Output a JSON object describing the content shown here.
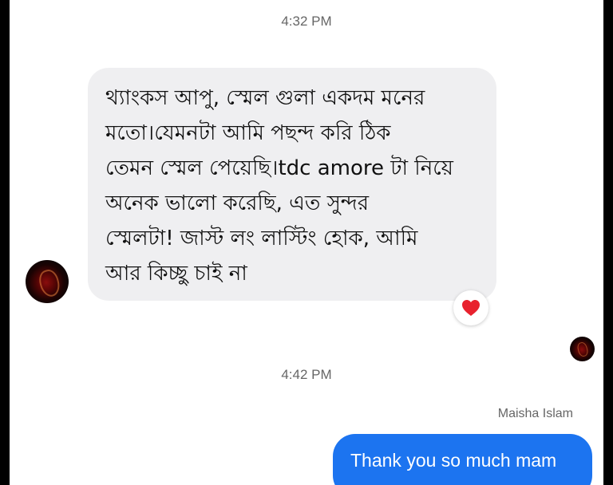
{
  "timestamps": [
    "4:32 PM",
    "4:42 PM"
  ],
  "incoming": {
    "text": "থ্যাংকস আপু, স্মেল গুলা একদম মনের\nমতো।যেমনটা আমি পছন্দ করি ঠিক\nতেমন স্মেল পেয়েছি।tdc amore টা নিয়ে\nঅনেক ভালো করেছি, এত সুন্দর\nস্মেলটা! জাস্ট লং লাস্টিং হোক, আমি\nআর কিচ্ছু চাই না",
    "reaction_icon": "heart-icon",
    "reaction_color": "#e8222e",
    "bubble_color": "#efeff1"
  },
  "outgoing": {
    "sender_name": "Maisha Islam",
    "text": "Thank you so much mam",
    "bubble_color": "#1c74f0"
  }
}
